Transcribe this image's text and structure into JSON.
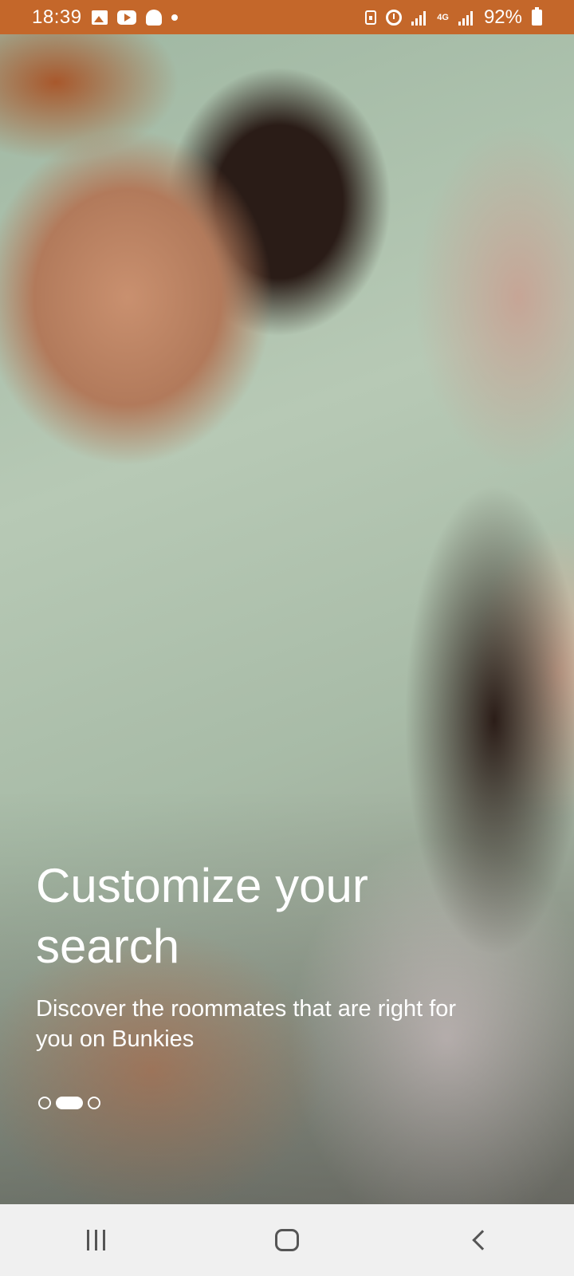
{
  "status_bar": {
    "time": "18:39",
    "network": "4G",
    "battery": "92%",
    "left_icons": [
      "image-icon",
      "youtube-icon",
      "snapchat-icon",
      "notification-dot-icon"
    ],
    "right_icons": [
      "lock-icon",
      "alarm-icon",
      "signal-icon",
      "signal-icon",
      "battery-icon"
    ],
    "background": "#c4672a"
  },
  "onboarding": {
    "title": "Customize your search",
    "subtitle": "Discover the roommates that are right for you on Bunkies",
    "pager": {
      "total": 3,
      "active_index": 1
    }
  },
  "nav_bar": {
    "buttons": [
      "recent-apps",
      "home",
      "back"
    ]
  }
}
